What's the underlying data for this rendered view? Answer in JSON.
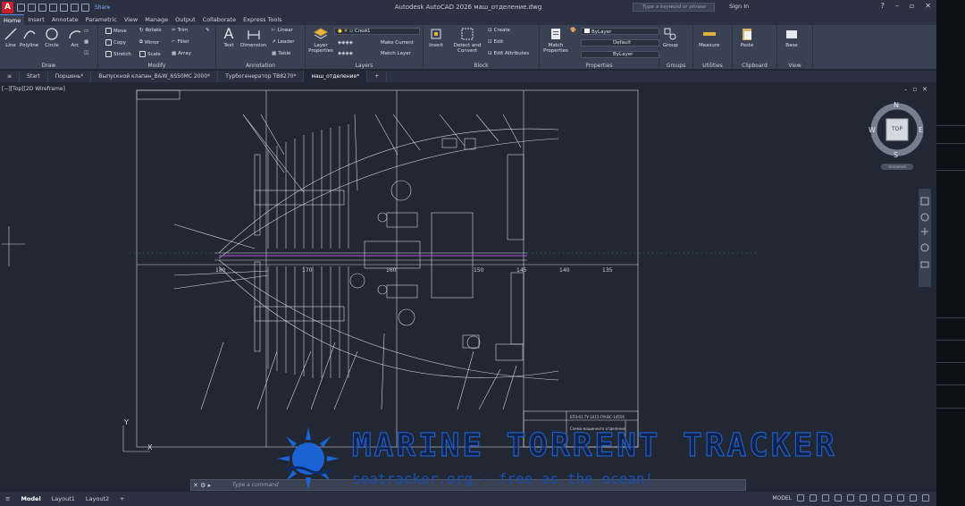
{
  "titlebar": {
    "app_icon": "A",
    "share_label": "Share",
    "title": "Autodesk AutoCAD 2026    маш_отделение.dwg",
    "search_placeholder": "Type a keyword or phrase",
    "signin_label": "Sign In",
    "help_label": "?"
  },
  "tabs": [
    "Home",
    "Insert",
    "Annotate",
    "Parametric",
    "View",
    "Manage",
    "Output",
    "Collaborate",
    "Express Tools"
  ],
  "ribbon": {
    "draw": {
      "title": "Draw",
      "line": "Line",
      "polyline": "Polyline",
      "circle": "Circle",
      "arc": "Arc"
    },
    "modify": {
      "title": "Modify",
      "move": "Move",
      "rotate": "Rotate",
      "trim": "Trim",
      "copy": "Copy",
      "mirror": "Mirror",
      "fillet": "Fillet",
      "stretch": "Stretch",
      "scale": "Scale",
      "array": "Array"
    },
    "annotation": {
      "title": "Annotation",
      "text": "Text",
      "dimension": "Dimension",
      "linear": "Linear",
      "leader": "Leader",
      "table": "Table"
    },
    "layers": {
      "title": "Layers",
      "layer_properties": "Layer Properties",
      "current_layer": "Слой1",
      "make_current": "Make Current",
      "match_layer": "Match Layer"
    },
    "block": {
      "title": "Block",
      "insert": "Insert",
      "detect_convert": "Detect and Convert",
      "create": "Create",
      "edit": "Edit",
      "edit_attributes": "Edit Attributes"
    },
    "properties": {
      "title": "Properties",
      "match_properties": "Match Properties",
      "color": "ByLayer",
      "lineweight": "Default",
      "linetype": "ByLayer"
    },
    "groups": {
      "title": "Groups",
      "group": "Group"
    },
    "utilities": {
      "title": "Utilities",
      "measure": "Measure"
    },
    "clipboard": {
      "title": "Clipboard",
      "paste": "Paste"
    },
    "view": {
      "title": "View",
      "base": "Base"
    }
  },
  "file_tabs": [
    "Start",
    "Поршень*",
    "Выпускной клапан_B&W_6S50MC 2000*",
    "Турбогенератор ТВ8270*",
    "маш_отделение*"
  ],
  "viewport": {
    "label": "[−][Top][2D Wireframe]",
    "viewcube": {
      "top": "TOP",
      "n": "N",
      "s": "S",
      "e": "E",
      "w": "W",
      "ucs": "Unnamed"
    },
    "dimension_labels": [
      "180",
      "170",
      "160",
      "150",
      "145",
      "140",
      "135"
    ],
    "title_block_text": [
      "ЕПЗ-01.ТУ-1015-ГМ-ВС-14556",
      "Схема машинного отделения"
    ],
    "ucs_y": "Y",
    "ucs_x": "X"
  },
  "command": {
    "placeholder": "Type a command"
  },
  "status": {
    "layouts": [
      "Model",
      "Layout1",
      "Layout2"
    ],
    "add": "+",
    "model_label": "MODEL"
  },
  "watermark": {
    "title": "MARINE TORRENT TRACKER",
    "subtitle": "seatracker.org - free as the ocean!"
  },
  "colors": {
    "accent": "#4f8fe0",
    "logo_red": "#c8202b",
    "ribbon_bg": "#3a4152",
    "canvas_bg": "#212733",
    "centerline": "#b050e0"
  }
}
